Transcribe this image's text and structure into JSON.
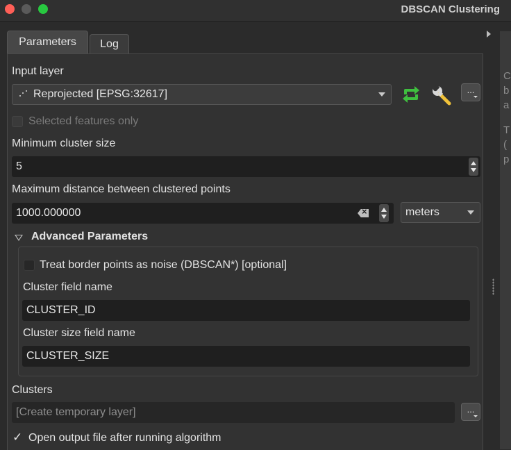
{
  "window": {
    "title": "DBSCAN Clustering"
  },
  "tabs": [
    {
      "label": "Parameters",
      "active": true
    },
    {
      "label": "Log",
      "active": false
    }
  ],
  "input_layer": {
    "label": "Input layer",
    "value": "Reprojected [EPSG:32617]",
    "more_button": "...",
    "icons": [
      "iterate-icon",
      "wrench-icon"
    ]
  },
  "selected_features": {
    "label": "Selected features only",
    "checked": false,
    "enabled": false
  },
  "min_cluster_size": {
    "label": "Minimum cluster size",
    "value": "5"
  },
  "max_distance": {
    "label": "Maximum distance between clustered points",
    "value": "1000.000000",
    "unit": "meters"
  },
  "advanced": {
    "header": "Advanced Parameters",
    "expanded": true,
    "border_noise": {
      "label": "Treat border points as noise (DBSCAN*) [optional]",
      "checked": false
    },
    "cluster_field": {
      "label": "Cluster field name",
      "value": "CLUSTER_ID"
    },
    "cluster_size_field": {
      "label": "Cluster size field name",
      "value": "CLUSTER_SIZE"
    }
  },
  "clusters": {
    "label": "Clusters",
    "placeholder": "[Create temporary layer]",
    "more_button": "..."
  },
  "open_output": {
    "label": "Open output file after running algorithm",
    "checked": true,
    "check_glyph": "✓"
  },
  "help_panel": {
    "chars": [
      "C",
      "b",
      "a",
      "T",
      "(",
      "p"
    ]
  },
  "colors": {
    "iterate_icon": "#3fbf3f",
    "wrench_icon": "#d8d8d8",
    "panel_bg": "#323232",
    "field_bg": "#1f1f1f"
  }
}
